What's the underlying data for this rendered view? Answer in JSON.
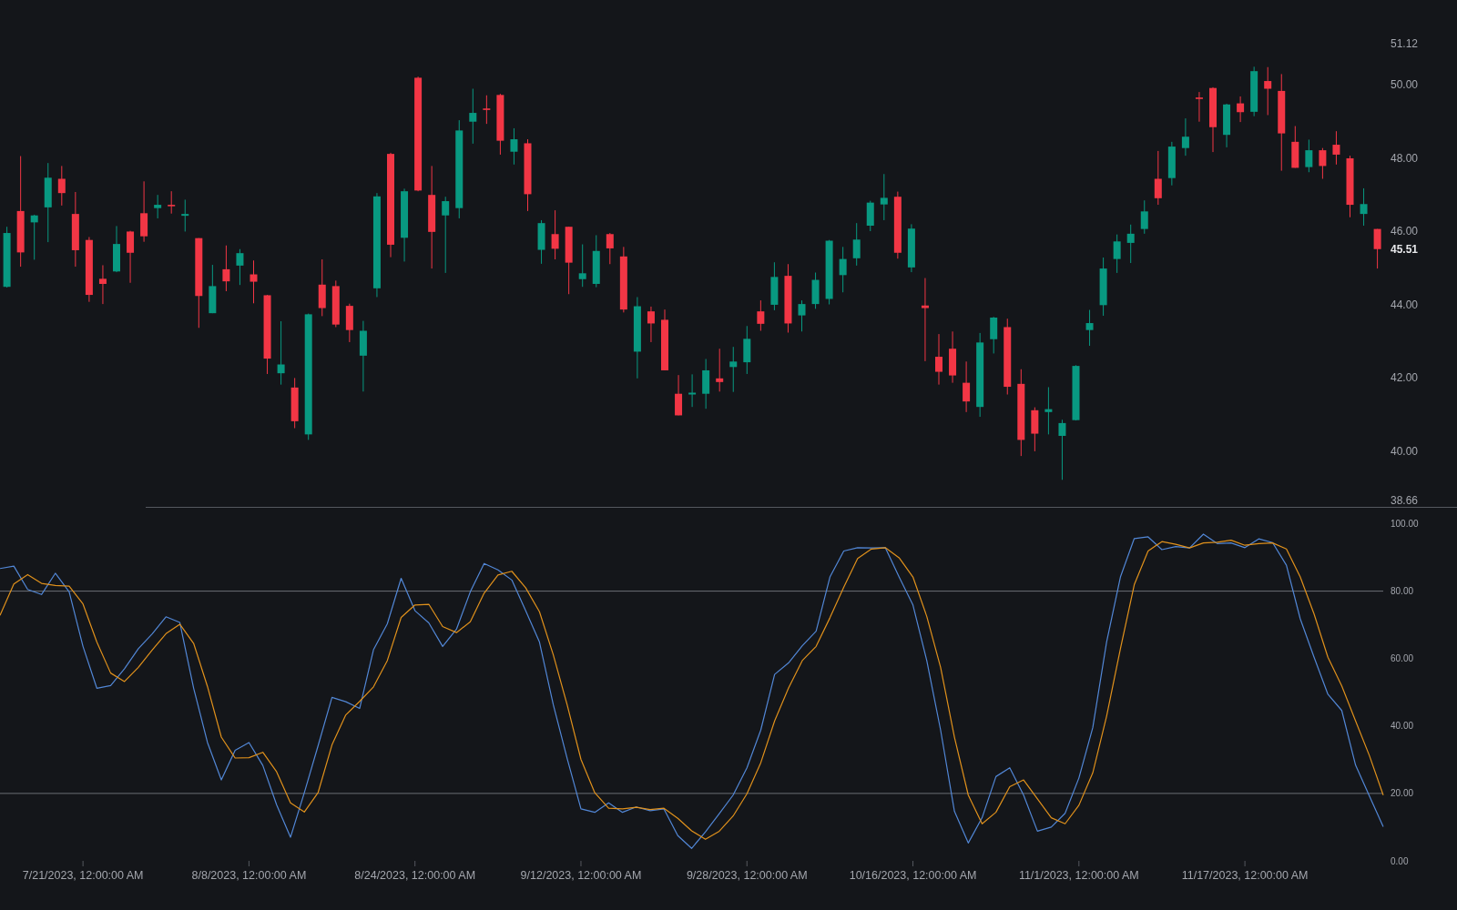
{
  "price_pane": {
    "chart_data": {
      "type": "candlestick",
      "ylim": [
        38.66,
        51.12
      ],
      "yticks": [
        {
          "value": 51.12,
          "label": "51.12"
        },
        {
          "value": 50,
          "label": "50.00"
        },
        {
          "value": 48,
          "label": "48.00"
        },
        {
          "value": 46,
          "label": "46.00"
        },
        {
          "value": 44,
          "label": "44.00"
        },
        {
          "value": 42,
          "label": "42.00"
        },
        {
          "value": 40,
          "label": "40.00"
        },
        {
          "value": 38.66,
          "label": "38.66"
        }
      ],
      "categories": [
        null,
        null,
        null,
        null,
        null,
        null,
        null,
        null,
        null,
        null,
        null,
        null,
        null,
        null,
        null,
        null,
        null,
        null,
        null,
        null,
        null,
        null,
        null,
        null,
        null,
        null,
        null,
        null,
        null,
        null,
        null,
        null,
        null,
        null,
        null,
        null,
        null,
        null,
        null,
        null,
        null,
        null,
        null,
        null,
        null,
        null,
        null,
        null,
        null,
        null,
        null,
        null,
        null,
        null,
        null,
        null,
        null,
        null,
        null,
        null,
        null,
        null,
        null,
        null,
        null,
        null,
        null,
        null,
        null,
        null,
        null,
        null,
        null,
        null,
        null,
        null,
        null,
        null,
        null,
        null,
        null,
        null,
        null,
        null,
        null,
        null,
        null,
        null,
        null,
        null,
        null,
        null,
        null,
        null,
        null,
        null,
        null,
        null,
        null,
        null,
        null
      ],
      "ohlc": [
        [
          44.48,
          46.12,
          44.46,
          45.95
        ],
        [
          46.55,
          48.05,
          45.03,
          45.42
        ],
        [
          46.24,
          46.45,
          45.22,
          46.43
        ],
        [
          46.65,
          47.86,
          45.7,
          47.46
        ],
        [
          47.43,
          47.78,
          46.7,
          47.04
        ],
        [
          46.47,
          47.07,
          45.03,
          45.48
        ],
        [
          45.76,
          45.84,
          44.07,
          44.26
        ],
        [
          44.7,
          45.07,
          44.01,
          44.56
        ],
        [
          44.9,
          46.14,
          44.88,
          45.65
        ],
        [
          45.99,
          46.01,
          44.59,
          45.41
        ],
        [
          46.49,
          47.36,
          45.71,
          45.86
        ],
        [
          46.63,
          46.99,
          46.35,
          46.72
        ],
        [
          46.72,
          47.09,
          46.48,
          46.68
        ],
        [
          46.42,
          46.86,
          45.99,
          46.47
        ],
        [
          45.81,
          45.81,
          43.36,
          44.23
        ],
        [
          43.76,
          45.08,
          43.76,
          44.5
        ],
        [
          44.96,
          45.61,
          44.36,
          44.63
        ],
        [
          45.06,
          45.51,
          44.53,
          45.4
        ],
        [
          44.82,
          45.2,
          44.03,
          44.62
        ],
        [
          44.25,
          44.26,
          42.1,
          42.52
        ],
        [
          42.12,
          43.54,
          41.81,
          42.36
        ],
        [
          41.73,
          41.99,
          40.62,
          40.81
        ],
        [
          40.45,
          43.75,
          40.3,
          43.73
        ],
        [
          44.54,
          45.23,
          43.68,
          43.9
        ],
        [
          44.5,
          44.65,
          43.38,
          43.45
        ],
        [
          43.96,
          44.02,
          42.97,
          43.3
        ],
        [
          42.6,
          43.55,
          41.62,
          43.28
        ],
        [
          44.44,
          47.04,
          44.2,
          46.95
        ],
        [
          48.11,
          48.14,
          45.29,
          45.63
        ],
        [
          45.82,
          47.16,
          45.17,
          47.09
        ],
        [
          50.19,
          50.22,
          47.09,
          47.11
        ],
        [
          46.99,
          47.78,
          44.98,
          45.98
        ],
        [
          46.43,
          46.94,
          44.86,
          46.82
        ],
        [
          46.63,
          49.03,
          46.35,
          48.75
        ],
        [
          48.99,
          49.89,
          48.39,
          49.23
        ],
        [
          49.35,
          49.71,
          48.93,
          49.31
        ],
        [
          49.72,
          49.75,
          48.09,
          48.47
        ],
        [
          48.17,
          48.81,
          47.82,
          48.51
        ],
        [
          48.4,
          48.51,
          46.55,
          47.01
        ],
        [
          45.49,
          46.3,
          45.11,
          46.22
        ],
        [
          45.92,
          46.57,
          45.23,
          45.52
        ],
        [
          46.12,
          46.12,
          44.28,
          45.14
        ],
        [
          44.69,
          45.64,
          44.48,
          44.85
        ],
        [
          44.56,
          45.89,
          44.47,
          45.46
        ],
        [
          45.92,
          45.95,
          45.1,
          45.53
        ],
        [
          45.31,
          45.57,
          43.78,
          43.86
        ],
        [
          42.71,
          44.2,
          41.98,
          43.95
        ],
        [
          43.81,
          43.94,
          42.97,
          43.48
        ],
        [
          43.58,
          43.86,
          42.2,
          42.2
        ],
        [
          41.56,
          42.07,
          40.97,
          40.97
        ],
        [
          41.54,
          42.09,
          41.2,
          41.59
        ],
        [
          41.56,
          42.51,
          41.15,
          42.2
        ],
        [
          41.98,
          42.79,
          41.62,
          41.88
        ],
        [
          42.29,
          42.84,
          41.61,
          42.44
        ],
        [
          42.42,
          43.41,
          42.1,
          43.06
        ],
        [
          43.81,
          44.11,
          43.28,
          43.47
        ],
        [
          43.99,
          45.15,
          43.84,
          44.75
        ],
        [
          44.78,
          45.1,
          43.23,
          43.48
        ],
        [
          43.7,
          44.11,
          43.26,
          44.01
        ],
        [
          44.01,
          44.87,
          43.88,
          44.67
        ],
        [
          44.15,
          45.76,
          44.0,
          45.74
        ],
        [
          44.8,
          45.57,
          44.33,
          45.24
        ],
        [
          45.26,
          46.22,
          45.06,
          45.77
        ],
        [
          46.15,
          46.83,
          46.0,
          46.78
        ],
        [
          46.73,
          47.56,
          46.3,
          46.91
        ],
        [
          46.94,
          47.08,
          45.25,
          45.41
        ],
        [
          45.01,
          46.19,
          44.88,
          46.07
        ],
        [
          43.97,
          44.72,
          42.45,
          43.9
        ],
        [
          42.57,
          43.19,
          41.81,
          42.16
        ],
        [
          42.79,
          43.26,
          41.86,
          42.06
        ],
        [
          41.86,
          42.44,
          41.06,
          41.35
        ],
        [
          41.2,
          43.22,
          40.93,
          42.96
        ],
        [
          43.05,
          43.66,
          42.66,
          43.64
        ],
        [
          43.38,
          43.61,
          41.54,
          41.75
        ],
        [
          41.83,
          42.23,
          39.86,
          40.3
        ],
        [
          41.11,
          41.19,
          39.99,
          40.47
        ],
        [
          41.06,
          41.74,
          40.45,
          41.14
        ],
        [
          40.41,
          40.85,
          39.21,
          40.76
        ],
        [
          40.84,
          42.34,
          40.83,
          42.32
        ],
        [
          43.3,
          43.85,
          42.87,
          43.49
        ],
        [
          43.98,
          45.28,
          43.69,
          44.98
        ],
        [
          45.24,
          45.91,
          44.86,
          45.72
        ],
        [
          45.68,
          46.18,
          45.13,
          45.93
        ],
        [
          46.06,
          46.84,
          45.93,
          46.54
        ],
        [
          47.43,
          48.19,
          46.72,
          46.9
        ],
        [
          47.45,
          48.44,
          47.25,
          48.31
        ],
        [
          48.27,
          49.08,
          48.06,
          48.58
        ],
        [
          49.65,
          49.8,
          48.99,
          49.61
        ],
        [
          49.91,
          49.93,
          48.16,
          48.84
        ],
        [
          48.63,
          49.48,
          48.29,
          49.46
        ],
        [
          49.49,
          49.68,
          48.98,
          49.25
        ],
        [
          49.26,
          50.49,
          49.14,
          50.37
        ],
        [
          50.1,
          50.48,
          49.17,
          49.89
        ],
        [
          49.83,
          50.29,
          47.65,
          48.67
        ],
        [
          48.44,
          48.87,
          47.73,
          47.73
        ],
        [
          47.75,
          48.5,
          47.61,
          48.21
        ],
        [
          48.21,
          48.27,
          47.43,
          47.78
        ],
        [
          48.36,
          48.73,
          47.82,
          48.09
        ],
        [
          47.99,
          48.06,
          46.38,
          46.72
        ],
        [
          46.47,
          47.17,
          46.15,
          46.74
        ],
        [
          46.06,
          46.06,
          44.98,
          45.51
        ]
      ],
      "annotations": [
        "45.51"
      ]
    }
  },
  "oscillator_pane": {
    "chart_data": {
      "type": "line",
      "ylim": [
        0,
        100
      ],
      "yticks": [
        {
          "value": 100,
          "label": "100.00"
        },
        {
          "value": 80,
          "label": "80.00"
        },
        {
          "value": 60,
          "label": "60.00"
        },
        {
          "value": 40,
          "label": "40.00"
        },
        {
          "value": 20,
          "label": "20.00"
        },
        {
          "value": 0,
          "label": "0.00"
        }
      ],
      "categories": [
        null,
        null,
        null,
        null,
        null,
        null,
        "7/21/2023, 12:00:00 AM",
        null,
        null,
        null,
        null,
        null,
        null,
        null,
        null,
        null,
        null,
        null,
        "8/8/2023, 12:00:00 AM",
        null,
        null,
        null,
        null,
        null,
        null,
        null,
        null,
        null,
        null,
        null,
        "8/24/2023, 12:00:00 AM",
        null,
        null,
        null,
        null,
        null,
        null,
        null,
        null,
        null,
        null,
        null,
        "9/12/2023, 12:00:00 AM",
        null,
        null,
        null,
        null,
        null,
        null,
        null,
        null,
        null,
        null,
        null,
        "9/28/2023, 12:00:00 AM",
        null,
        null,
        null,
        null,
        null,
        null,
        null,
        null,
        null,
        null,
        null,
        "10/16/2023, 12:00:00 AM",
        null,
        null,
        null,
        null,
        null,
        null,
        null,
        null,
        null,
        null,
        null,
        "11/1/2023, 12:00:00 AM",
        null,
        null,
        null,
        null,
        null,
        null,
        null,
        null,
        null,
        null,
        null,
        "11/17/2023, 12:00:00 AM",
        null,
        null,
        null,
        null,
        null,
        null,
        null,
        null,
        null,
        null
      ],
      "series": [
        {
          "color": "#5287d6",
          "values": [
            86.7,
            87.4,
            80.5,
            79.0,
            85.3,
            79.8,
            63.6,
            51.2,
            52.0,
            57.0,
            62.9,
            67.3,
            72.4,
            70.7,
            51.2,
            35.1,
            24.0,
            32.8,
            35.1,
            28.3,
            16.6,
            7.0,
            20.2,
            34.2,
            48.5,
            47.2,
            45.2,
            62.6,
            70.3,
            83.8,
            74.2,
            70.6,
            63.6,
            68.7,
            79.8,
            88.2,
            86.3,
            83.3,
            74.2,
            64.9,
            46.3,
            30.4,
            15.4,
            14.4,
            17.2,
            14.4,
            16.0,
            14.9,
            15.4,
            7.5,
            3.7,
            8.6,
            14.0,
            19.5,
            27.6,
            38.8,
            55.3,
            58.7,
            63.8,
            68.1,
            84.2,
            91.9,
            92.9,
            92.8,
            92.9,
            84.2,
            75.9,
            59.4,
            38.8,
            14.7,
            5.3,
            12.8,
            25.0,
            27.6,
            19.5,
            8.8,
            10.0,
            14.1,
            24.6,
            39.5,
            64.9,
            84.2,
            95.6,
            96.1,
            92.3,
            93.2,
            92.8,
            96.9,
            94.1,
            94.3,
            92.9,
            95.5,
            94.4,
            87.7,
            71.8,
            60.4,
            49.4,
            44.6,
            28.4,
            19.2,
            10.1
          ]
        },
        {
          "color": "#e0911c",
          "values": [
            72.8,
            82.1,
            84.9,
            82.3,
            81.7,
            81.5,
            76.2,
            64.9,
            55.7,
            53.2,
            57.4,
            62.5,
            67.4,
            70.2,
            64.5,
            51.7,
            36.7,
            30.5,
            30.6,
            32.2,
            26.4,
            17.2,
            14.5,
            20.3,
            34.4,
            43.3,
            47.3,
            51.6,
            59.4,
            72.2,
            75.9,
            76.1,
            69.5,
            67.7,
            70.9,
            79.4,
            84.8,
            85.9,
            81.0,
            73.9,
            61.1,
            46.3,
            30.1,
            20.2,
            15.6,
            15.4,
            15.9,
            15.2,
            15.6,
            12.6,
            8.9,
            6.4,
            8.8,
            13.3,
            19.9,
            29.1,
            41.5,
            51.2,
            59.4,
            63.6,
            72.1,
            81.2,
            89.7,
            92.5,
            92.9,
            89.9,
            84.2,
            72.5,
            57.4,
            36.7,
            19.5,
            11.0,
            14.4,
            22.0,
            24.0,
            18.4,
            12.8,
            11.0,
            16.5,
            26.1,
            42.9,
            62.9,
            81.9,
            91.9,
            94.7,
            93.9,
            92.8,
            94.3,
            94.5,
            95.1,
            93.6,
            94.1,
            94.3,
            92.5,
            84.2,
            73.2,
            60.4,
            51.9,
            41.5,
            31.2,
            19.5
          ]
        }
      ],
      "ref_lines": [
        {
          "axis": "y",
          "value": 80
        },
        {
          "axis": "y",
          "value": 20
        }
      ]
    }
  }
}
